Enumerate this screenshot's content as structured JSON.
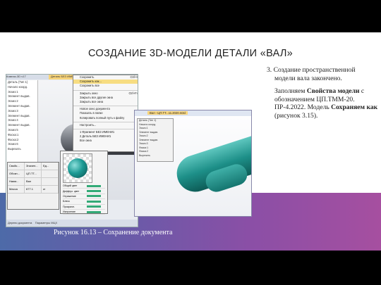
{
  "slide": {
    "title": "СОЗДАНИЕ 3D-МОДЕЛИ ДЕТАЛИ «ВАЛ»",
    "step_line1": "3. Создание пространственной",
    "step_line2": "модели вала закончено.",
    "para_pre": "Заполняем ",
    "para_bold1": "Свойства модели",
    "para_mid": " с обозначением ЦП.ТММ-20. ПР-4.2022. Модель ",
    "para_bold2": "Сохраняем как",
    "para_post": " (рисунок 3.15).",
    "caption": "Рисунок 16.13 – Сохранение документа"
  },
  "shot1": {
    "window_title": "Компас-3D v17",
    "active_tab": "Деталь БЕЗ ИМЕНИ1",
    "tree_items": [
      "Деталь (Тип 1)",
      "Начало коорд.",
      "Эскиз:1",
      "Элемент выдав.",
      "Эскиз:2",
      "Элемент выдав.",
      "Эскиз:3",
      "Элемент выдав.",
      "Эскиз:4",
      "Элемент выдав.",
      "Эскиз:5",
      "Фаска:1",
      "Фаска:2",
      "Эскиз:6",
      "Вырезать"
    ],
    "menu_items": [
      {
        "label": "Сохранить",
        "key": "Ctrl+S",
        "highlight": false
      },
      {
        "label": "Сохранить как...",
        "key": "",
        "highlight": true
      },
      {
        "label": "Сохранить все",
        "key": "",
        "highlight": false
      },
      {
        "label": "sep"
      },
      {
        "label": "Закрыть окно",
        "key": "Ctrl+F4",
        "highlight": false
      },
      {
        "label": "Закрыть все другие окна",
        "key": "",
        "highlight": false
      },
      {
        "label": "Закрыть все окна",
        "key": "",
        "highlight": false
      },
      {
        "label": "sep"
      },
      {
        "label": "Новое окно документа",
        "key": "",
        "highlight": false
      },
      {
        "label": "Показать в папке",
        "key": "",
        "highlight": false
      },
      {
        "label": "Копировать полный путь к файлу",
        "key": "",
        "highlight": false
      },
      {
        "label": "sep"
      },
      {
        "label": "Настроить...",
        "key": "",
        "highlight": false
      },
      {
        "label": "sep"
      },
      {
        "label": "1 Фрагмент БЕЗ ИМЕНИ1",
        "key": "",
        "highlight": false
      },
      {
        "label": "2 Деталь БЕЗ ИМЕНИ1",
        "key": "",
        "highlight": false
      },
      {
        "label": "Все окна",
        "key": "",
        "highlight": false
      }
    ],
    "props_rows": [
      [
        "Свойс...",
        "Значен...",
        "Ед..."
      ],
      [
        "Обозн...",
        "ЦП.ТТ...",
        ""
      ],
      [
        "Наим...",
        "Вал",
        ""
      ],
      [
        "Масса",
        "677.1",
        "кг"
      ]
    ],
    "color_rows": [
      "Общий цвет",
      "Диффуз. цвет",
      "Отражение",
      "Блеск",
      "Прозрачн.",
      "Излучение"
    ],
    "status_left": "Дерево документа",
    "status_right": "Параметры МЦХ"
  },
  "shot2": {
    "tab_title": "Вал - ЦП.ТТ...11.2020.m3d",
    "dropdown_items": [
      "Деталь (Тип 1)",
      "Начало коорд.",
      "Эскиз:1",
      "Элемент выдав.",
      "Эскиз:2",
      "Элемент выдав.",
      "Эскиз:3",
      "Фаска:1",
      "Фаска:2",
      "Вырезать"
    ]
  }
}
